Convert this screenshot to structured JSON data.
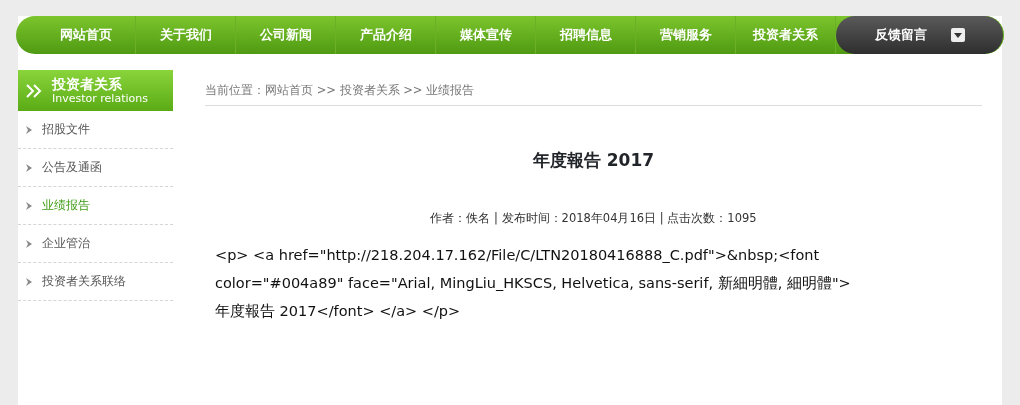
{
  "nav": [
    {
      "label": "网站首页",
      "kind": "link"
    },
    {
      "label": "关于我们",
      "kind": "link"
    },
    {
      "label": "公司新闻",
      "kind": "link"
    },
    {
      "label": "产品介绍",
      "kind": "link"
    },
    {
      "label": "媒体宣传",
      "kind": "link"
    },
    {
      "label": "招聘信息",
      "kind": "link"
    },
    {
      "label": "营销服务",
      "kind": "link"
    },
    {
      "label": "投资者关系",
      "kind": "link"
    },
    {
      "label": "反馈留言",
      "kind": "dropdown"
    }
  ],
  "sidebar": {
    "title": "投资者关系",
    "subtitle": "Investor relations",
    "items": [
      {
        "label": "招股文件",
        "selected": false
      },
      {
        "label": "公告及通函",
        "selected": false
      },
      {
        "label": "业绩报告",
        "selected": true
      },
      {
        "label": "企业管治",
        "selected": false
      },
      {
        "label": "投资者关系联络",
        "selected": false
      }
    ]
  },
  "breadcrumb": "当前位置：网站首页 >> 投资者关系 >> 业绩报告",
  "article": {
    "title": "年度報告 2017",
    "meta": "作者：佚名 |  发布时间：2018年04月16日 |  点击次数：1095",
    "body": "<p> <a href=\"http://218.204.17.162/File/C/LTN20180416888_C.pdf\">&nbsp;<font color=\"#004a89\" face=\"Arial, MingLiu_HKSCS, Helvetica, sans-serif, 新細明體, 細明體\">年度報告 2017</font> </a> </p>"
  }
}
